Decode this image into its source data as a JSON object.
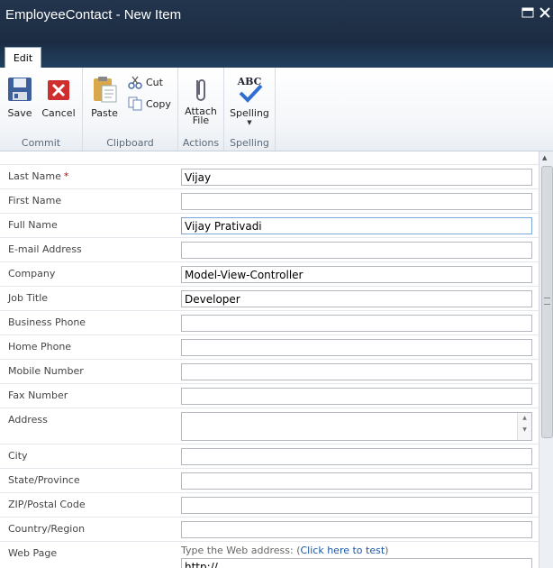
{
  "window": {
    "title": "EmployeeContact - New Item"
  },
  "tabs": [
    {
      "label": "Edit"
    }
  ],
  "ribbon": {
    "groups": {
      "commit": {
        "label": "Commit",
        "save": "Save",
        "cancel": "Cancel"
      },
      "clipboard": {
        "label": "Clipboard",
        "paste": "Paste",
        "cut": "Cut",
        "copy": "Copy"
      },
      "actions": {
        "label": "Actions",
        "attach_line1": "Attach",
        "attach_line2": "File"
      },
      "spelling": {
        "label": "Spelling",
        "spelling": "Spelling",
        "abc": "ABC"
      }
    }
  },
  "form": {
    "fields": [
      {
        "label": "Last Name",
        "required": "*",
        "value": "Vijay"
      },
      {
        "label": "First Name",
        "value": ""
      },
      {
        "label": "Full Name",
        "value": "Vijay Prativadi"
      },
      {
        "label": "E-mail Address",
        "value": ""
      },
      {
        "label": "Company",
        "value": "Model-View-Controller"
      },
      {
        "label": "Job Title",
        "value": "Developer"
      },
      {
        "label": "Business Phone",
        "value": ""
      },
      {
        "label": "Home Phone",
        "value": ""
      },
      {
        "label": "Mobile Number",
        "value": ""
      },
      {
        "label": "Fax Number",
        "value": ""
      },
      {
        "label": "Address",
        "value": ""
      },
      {
        "label": "City",
        "value": ""
      },
      {
        "label": "State/Province",
        "value": ""
      },
      {
        "label": "ZIP/Postal Code",
        "value": ""
      },
      {
        "label": "Country/Region",
        "value": ""
      },
      {
        "label": "Web Page",
        "hint_prefix": "Type the Web address: (",
        "hint_link": "Click here to test",
        "hint_suffix": ")",
        "value": "http://"
      }
    ]
  },
  "colors": {
    "titlebar": "#1f3047",
    "required": "#cc0000",
    "link": "#1a56a6"
  }
}
